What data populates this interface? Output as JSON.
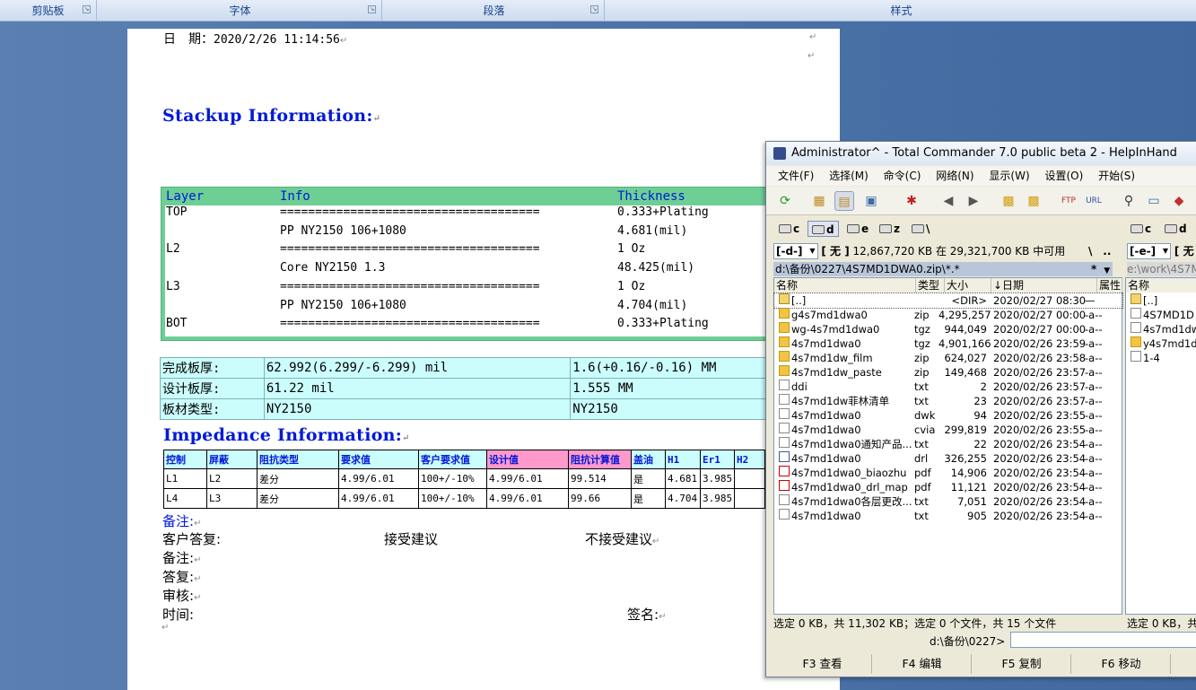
{
  "ribbon": {
    "groups": [
      "剪贴板",
      "字体",
      "段落",
      "样式"
    ]
  },
  "document": {
    "date_label": "日　期：",
    "date_value": "2020/2/26 11:14:56",
    "stackup_title": "Stackup Information:",
    "stack_headers": [
      "Layer",
      "Info",
      "Thickness"
    ],
    "stack_rows": [
      {
        "layer": "TOP",
        "info": "=====================================",
        "thickness": "0.333+Plating"
      },
      {
        "layer": "",
        "info": "PP     NY2150     106+1080",
        "thickness": "4.681(mil)"
      },
      {
        "layer": "L2",
        "info": "=====================================",
        "thickness": "1 Oz"
      },
      {
        "layer": "",
        "info": "Core     NY2150     1.3",
        "thickness": "48.425(mil)"
      },
      {
        "layer": "L3",
        "info": "=====================================",
        "thickness": "1 Oz"
      },
      {
        "layer": "",
        "info": "PP     NY2150     106+1080",
        "thickness": "4.704(mil)"
      },
      {
        "layer": "BOT",
        "info": "=====================================",
        "thickness": "0.333+Plating"
      }
    ],
    "thickness_table": [
      [
        "完成板厚:",
        "62.992(6.299/-6.299) mil",
        "1.6(+0.16/-0.16) MM"
      ],
      [
        "设计板厚:",
        "61.22 mil",
        "1.555 MM"
      ],
      [
        "板材类型:",
        "NY2150",
        "NY2150"
      ]
    ],
    "impedance_title": "Impedance Information:",
    "imp_headers": [
      "控制",
      "屏蔽",
      "阻抗类型",
      "要求值",
      "客户要求值",
      "设计值",
      "阻抗计算值",
      "盖油",
      "H1",
      "Er1",
      "H2"
    ],
    "imp_rows": [
      [
        "L1",
        "L2",
        "差分",
        "4.99/6.01",
        "100+/-10%",
        "4.99/6.01",
        "99.514",
        "是",
        "4.681",
        "3.985",
        ""
      ],
      [
        "L4",
        "L3",
        "差分",
        "4.99/6.01",
        "100+/-10%",
        "4.99/6.01",
        "99.66",
        "是",
        "4.704",
        "3.985",
        ""
      ]
    ],
    "notes": {
      "remark1": "备注:",
      "customer_reply": "客户答复:",
      "accept": "接受建议",
      "reject": "不接受建议",
      "remark2": "备注:",
      "reply": "答复:",
      "review": "审核:",
      "time": "时间:",
      "sign": "签名:"
    }
  },
  "total_commander": {
    "title": "Administrator^ - Total Commander 7.0 public beta 2 - HelpInHand",
    "menu": [
      "文件(F)",
      "选择(M)",
      "命令(C)",
      "网络(N)",
      "显示(W)",
      "设置(O)",
      "开始(S)"
    ],
    "drives": [
      "c",
      "d",
      "e",
      "z",
      "\\"
    ],
    "right_drives": [
      "c",
      "d"
    ],
    "left_drive_select": "[-d-]",
    "left_volume": "[ 无 ]",
    "left_free": "12,867,720 KB 在 29,321,700 KB 中可用",
    "nav_root": "\\",
    "nav_up": "..",
    "right_drive_select": "[-e-]",
    "right_volume": "[ 无",
    "left_path": "d:\\备份\\0227\\4S7MD1DWA0.zip\\*.*",
    "left_filter": "*",
    "right_path": "e:\\work\\4S7M",
    "columns": [
      "名称",
      "类型",
      "大小",
      "↓日期",
      "属性"
    ],
    "right_columns": [
      "名称"
    ],
    "files": [
      {
        "name": "[..]",
        "ext": "",
        "size": "<DIR>",
        "date": "2020/02/27 08:30",
        "attr": "—",
        "icon": "up"
      },
      {
        "name": "g4s7md1dwa0",
        "ext": "zip",
        "size": "4,295,257",
        "date": "2020/02/27 00:00",
        "attr": "-a--",
        "icon": "zip"
      },
      {
        "name": "wg-4s7md1dwa0",
        "ext": "tgz",
        "size": "944,049",
        "date": "2020/02/27 00:00",
        "attr": "-a--",
        "icon": "zip"
      },
      {
        "name": "4s7md1dwa0",
        "ext": "tgz",
        "size": "4,901,166",
        "date": "2020/02/26 23:59",
        "attr": "-a--",
        "icon": "zip"
      },
      {
        "name": "4s7md1dw_film",
        "ext": "zip",
        "size": "624,027",
        "date": "2020/02/26 23:58",
        "attr": "-a--",
        "icon": "zip"
      },
      {
        "name": "4s7md1dw_paste",
        "ext": "zip",
        "size": "149,468",
        "date": "2020/02/26 23:57",
        "attr": "-a--",
        "icon": "zip"
      },
      {
        "name": "ddi",
        "ext": "txt",
        "size": "2",
        "date": "2020/02/26 23:57",
        "attr": "-a--",
        "icon": "txt"
      },
      {
        "name": "4s7md1dw菲林清单",
        "ext": "txt",
        "size": "23",
        "date": "2020/02/26 23:57",
        "attr": "-a--",
        "icon": "txt"
      },
      {
        "name": "4s7md1dwa0",
        "ext": "dwk",
        "size": "94",
        "date": "2020/02/26 23:55",
        "attr": "-a--",
        "icon": "txt"
      },
      {
        "name": "4s7md1dwa0",
        "ext": "cvia",
        "size": "299,819",
        "date": "2020/02/26 23:55",
        "attr": "-a--",
        "icon": "txt"
      },
      {
        "name": "4s7md1dwa0通知产品...",
        "ext": "txt",
        "size": "22",
        "date": "2020/02/26 23:54",
        "attr": "-a--",
        "icon": "txt"
      },
      {
        "name": "4s7md1dwa0",
        "ext": "drl",
        "size": "326,255",
        "date": "2020/02/26 23:54",
        "attr": "-a--",
        "icon": "drl"
      },
      {
        "name": "4s7md1dwa0_biaozhu",
        "ext": "pdf",
        "size": "14,906",
        "date": "2020/02/26 23:54",
        "attr": "-a--",
        "icon": "pdf"
      },
      {
        "name": "4s7md1dwa0_drl_map",
        "ext": "pdf",
        "size": "11,121",
        "date": "2020/02/26 23:54",
        "attr": "-a--",
        "icon": "pdf"
      },
      {
        "name": "4s7md1dwa0各层更改...",
        "ext": "txt",
        "size": "7,051",
        "date": "2020/02/26 23:54",
        "attr": "-a--",
        "icon": "txt"
      },
      {
        "name": "4s7md1dwa0",
        "ext": "txt",
        "size": "905",
        "date": "2020/02/26 23:54",
        "attr": "-a--",
        "icon": "txt"
      }
    ],
    "right_files": [
      "[..]",
      "4S7MD1D",
      "4s7md1dw",
      "y4s7md1dv",
      "1-4"
    ],
    "status": "选定 0 KB，共 11,302 KB；选定 0 个文件，共 15 个文件",
    "right_status": "选定 0 KB，共",
    "cmd_path": "d:\\备份\\0227>",
    "fkeys": [
      "F3 查看",
      "F4 编辑",
      "F5 复制",
      "F6 移动"
    ]
  }
}
